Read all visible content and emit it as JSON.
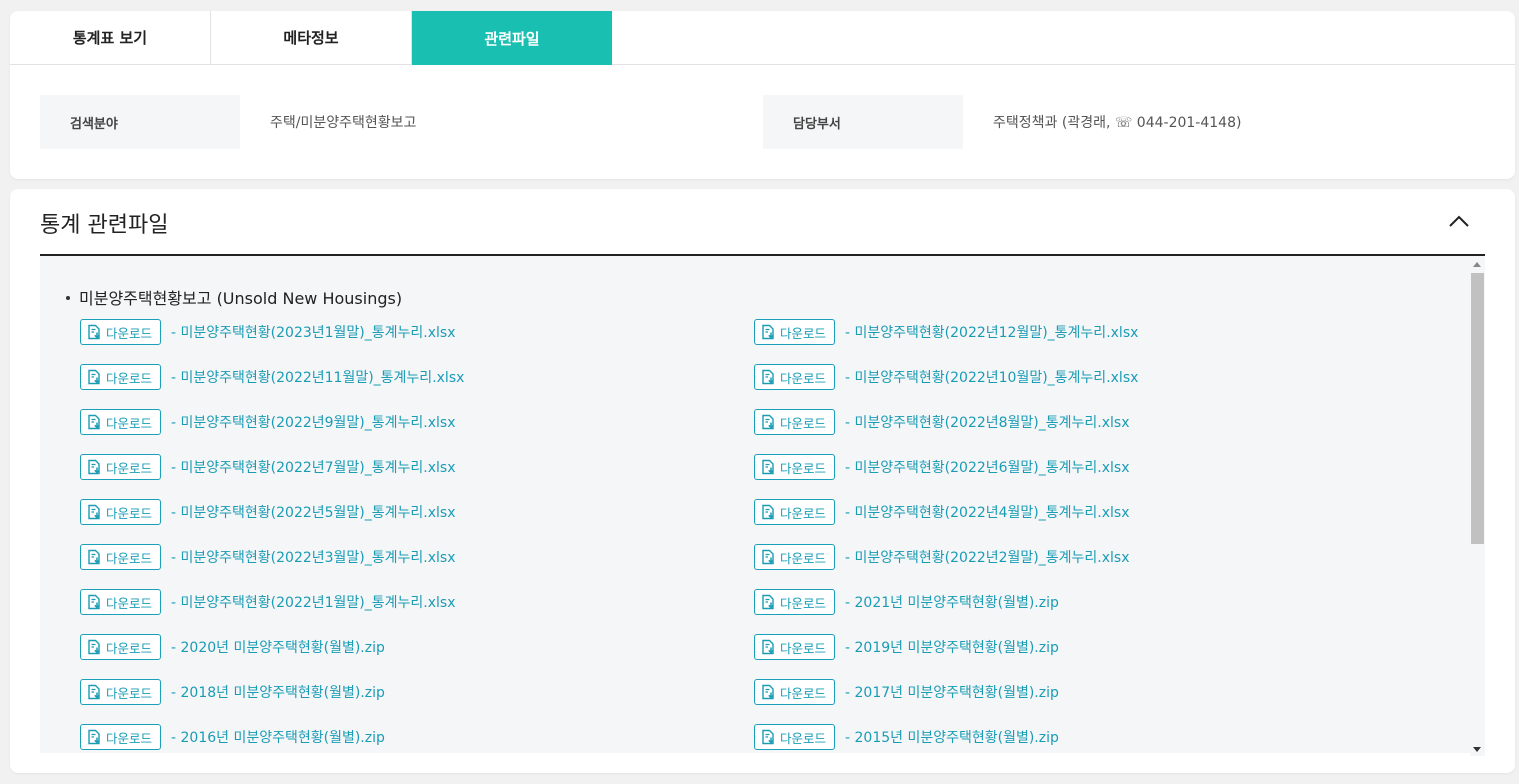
{
  "tabs": [
    {
      "label": "통계표 보기",
      "active": false
    },
    {
      "label": "메타정보",
      "active": false
    },
    {
      "label": "관련파일",
      "active": true
    }
  ],
  "info": {
    "field_label": "검색분야",
    "field_value": "주택/미분양주택현황보고",
    "dept_label": "담당부서",
    "dept_value": "주택정책과 (곽경래, ☏ 044-201-4148)"
  },
  "section": {
    "title": "통계 관련파일",
    "group_title": "미분양주택현황보고 (Unsold New Housings)"
  },
  "download_label": "다운로드",
  "files": [
    "- 미분양주택현황(2023년1월말)_통계누리.xlsx",
    "- 미분양주택현황(2022년12월말)_통계누리.xlsx",
    "- 미분양주택현황(2022년11월말)_통계누리.xlsx",
    "- 미분양주택현황(2022년10월말)_통계누리.xlsx",
    "- 미분양주택현황(2022년9월말)_통계누리.xlsx",
    "- 미분양주택현황(2022년8월말)_통계누리.xlsx",
    "- 미분양주택현황(2022년7월말)_통계누리.xlsx",
    "- 미분양주택현황(2022년6월말)_통계누리.xlsx",
    "- 미분양주택현황(2022년5월말)_통계누리.xlsx",
    "- 미분양주택현황(2022년4월말)_통계누리.xlsx",
    "- 미분양주택현황(2022년3월말)_통계누리.xlsx",
    "- 미분양주택현황(2022년2월말)_통계누리.xlsx",
    "- 미분양주택현황(2022년1월말)_통계누리.xlsx",
    "- 2021년 미분양주택현황(월별).zip",
    "- 2020년 미분양주택현황(월별).zip",
    "- 2019년 미분양주택현황(월별).zip",
    "- 2018년 미분양주택현황(월별).zip",
    "- 2017년 미분양주택현황(월별).zip",
    "- 2016년 미분양주택현황(월별).zip",
    "- 2015년 미분양주택현황(월별).zip"
  ],
  "colors": {
    "accent": "#19bfb1",
    "link": "#1a9cb5"
  },
  "icons": {
    "collapse": "chevron-up-icon",
    "download": "file-download-icon"
  }
}
